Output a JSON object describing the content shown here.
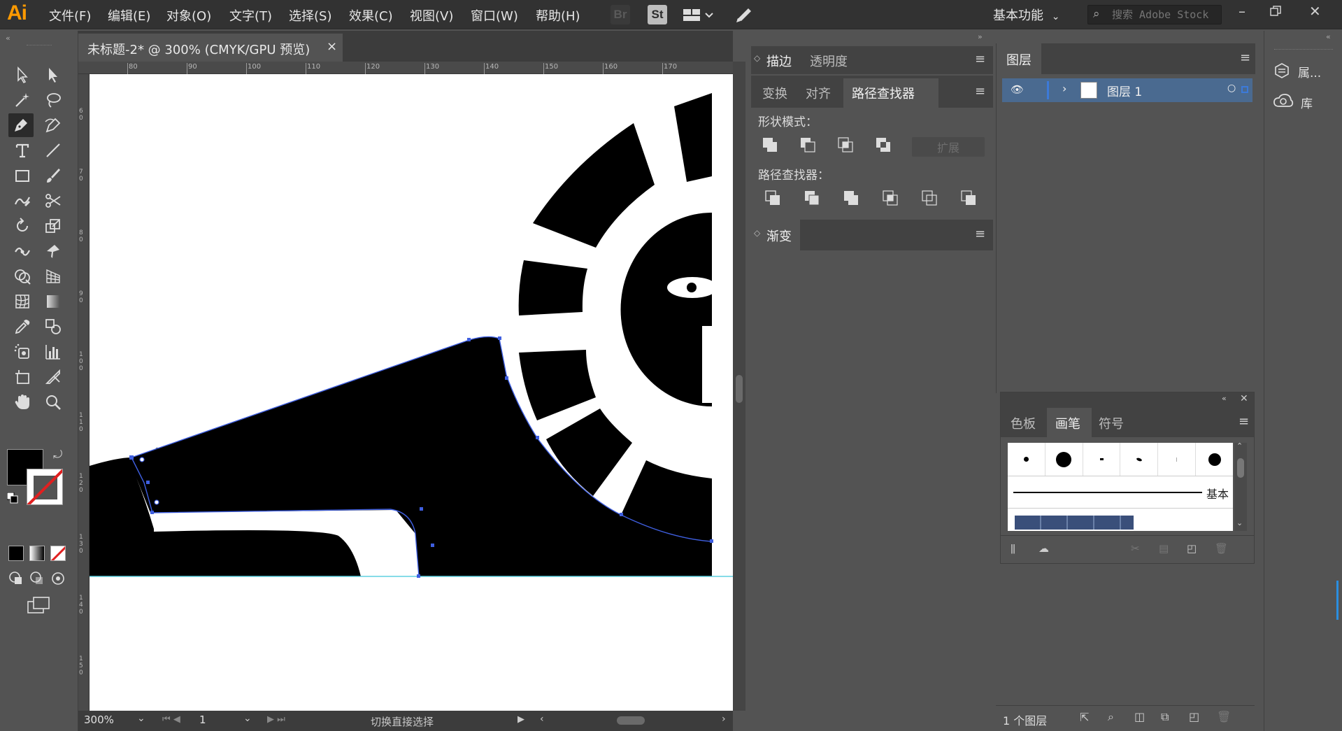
{
  "app": {
    "logo": "Ai"
  },
  "menu": [
    {
      "label": "文件(F)"
    },
    {
      "label": "编辑(E)"
    },
    {
      "label": "对象(O)"
    },
    {
      "label": "文字(T)"
    },
    {
      "label": "选择(S)"
    },
    {
      "label": "效果(C)"
    },
    {
      "label": "视图(V)"
    },
    {
      "label": "窗口(W)"
    },
    {
      "label": "帮助(H)"
    }
  ],
  "toolbar": {
    "bridge": "Br",
    "stock": "St"
  },
  "workspace": {
    "label": "基本功能"
  },
  "search": {
    "placeholder": "搜索 Adobe Stock"
  },
  "document": {
    "tab_label": "未标题-2* @ 300% (CMYK/GPU 预览)",
    "close": "×"
  },
  "ruler": {
    "h_ticks": [
      "80",
      "90",
      "100",
      "110",
      "120",
      "130",
      "140",
      "150",
      "160",
      "170"
    ],
    "v_ticks": [
      "60",
      "70",
      "80",
      "90",
      "100",
      "110",
      "120",
      "130",
      "140",
      "150"
    ]
  },
  "status": {
    "zoom": "300%",
    "artboard": "1",
    "message": "切换直接选择"
  },
  "stroke_panel": {
    "tabs": [
      "描边",
      "透明度"
    ]
  },
  "pathfinder_panel": {
    "tabs": [
      "变换",
      "对齐",
      "路径查找器"
    ],
    "shape_modes_label": "形状模式：",
    "pathfinders_label": "路径查找器：",
    "expand_label": "扩展"
  },
  "gradient_panel": {
    "tab": "渐变"
  },
  "layers_panel": {
    "tab": "图层",
    "layers": [
      {
        "name": "图层 1"
      }
    ],
    "footer": "1 个图层"
  },
  "brushes_panel": {
    "tabs": [
      "色板",
      "画笔",
      "符号"
    ],
    "basic_label": "基本"
  },
  "dock": {
    "properties": "属...",
    "libraries": "库"
  },
  "colors": {
    "accent": "#4a90d9",
    "logo": "#ff9a00",
    "path": "#3f5fe0"
  }
}
